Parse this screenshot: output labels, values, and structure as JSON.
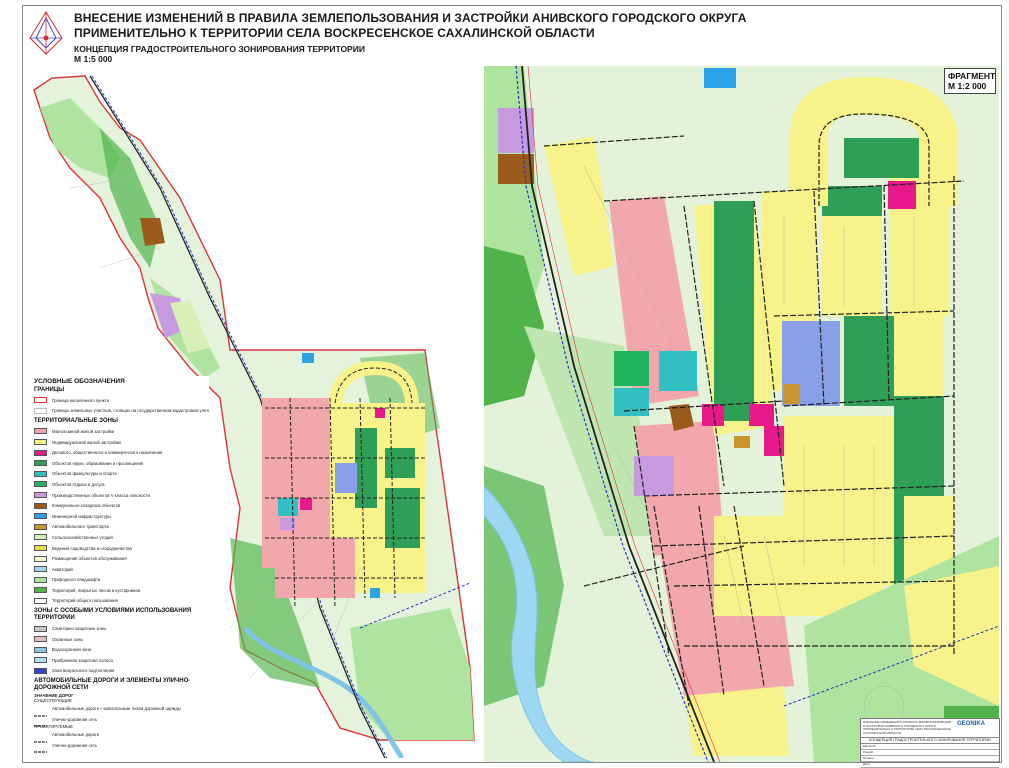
{
  "title": {
    "line1": "ВНЕСЕНИЕ ИЗМЕНЕНИЙ В ПРАВИЛА ЗЕМЛЕПОЛЬЗОВАНИЯ И ЗАСТРОЙКИ АНИВСКОГО ГОРОДСКОГО ОКРУГА",
    "line2": "ПРИМЕНИТЕЛЬНО К ТЕРРИТОРИИ СЕЛА ВОСКРЕСЕНСКОЕ САХАЛИНСКОЙ ОБЛАСТИ",
    "subtitle": "КОНЦЕПЦИЯ ГРАДОСТРОИТЕЛЬНОГО ЗОНИРОВАНИЯ ТЕРРИТОРИИ",
    "scale": "М 1:5 000"
  },
  "fragment": {
    "label": "ФРАГМЕНТ",
    "scale": "М 1:2 000"
  },
  "legend": {
    "heading": "УСЛОВНЫЕ ОБОЗНАЧЕНИЯ",
    "borders_heading": "ГРАНИЦЫ",
    "borders": [
      {
        "label": "Граница населенного пункта",
        "color": "#d9343a",
        "style": "box"
      },
      {
        "label": "Границы земельных участков, стоящих на государственном кадастровом учете",
        "color": "#bbbbbb",
        "style": "box"
      }
    ],
    "zones_heading": "ТЕРРИТОРИАЛЬНЫЕ ЗОНЫ",
    "zones": [
      {
        "label": "Малоэтажной жилой застройки",
        "color": "#f2a7ad"
      },
      {
        "label": "Индивидуальной жилой застройки",
        "color": "#f7f28a"
      },
      {
        "label": "Делового, общественного и коммерческого назначения",
        "color": "#e8198b"
      },
      {
        "label": "Объектов науки, образования и просвещения",
        "color": "#2f9e57"
      },
      {
        "label": "Объектов физкультуры и спорта",
        "color": "#31bfc1"
      },
      {
        "label": "Объектов отдыха и досуга",
        "color": "#1fb35d"
      },
      {
        "label": "Производственных объектов V класса опасности",
        "color": "#c79ae0"
      },
      {
        "label": "Коммунально-складских объектов",
        "color": "#9a5b1d"
      },
      {
        "label": "Инженерной инфраструктуры",
        "color": "#2aa4e6"
      },
      {
        "label": "Автомобильного транспорта",
        "color": "#c9952d"
      },
      {
        "label": "Сельскохозяйственных угодий",
        "color": "#d9efb8"
      },
      {
        "label": "Ведения садоводства и огородничества",
        "color": "#e1e14a"
      },
      {
        "label": "Размещения объектов обслуживания",
        "color": "#fbfbd0"
      },
      {
        "label": "Акваторий",
        "color": "#9ed7f2"
      },
      {
        "label": "Природного ландшафта",
        "color": "#aee3a0"
      },
      {
        "label": "Территорий, покрытых лесом и кустарником",
        "color": "#4fb34a"
      },
      {
        "label": "Территорий общего пользования",
        "color": "#ffffff"
      }
    ],
    "special_heading": "ЗОНЫ С ОСОБЫМИ УСЛОВИЯМИ ИСПОЛЬЗОВАНИЯ ТЕРРИТОРИИ",
    "special": [
      {
        "label": "Санитарно-защитные зоны",
        "color": "#c6c6c6"
      },
      {
        "label": "Охранные зоны",
        "color": "#e0c0c0"
      },
      {
        "label": "Водоохранная зона",
        "color": "#8fc6e8"
      },
      {
        "label": "Прибрежная защитная полоса",
        "color": "#b4e0f6"
      },
      {
        "label": "Зона визуального подтопления",
        "color": "#2b47c9"
      }
    ],
    "roads_heading": "АВТОМОБИЛЬНЫЕ ДОРОГИ И ЭЛЕМЕНТЫ УЛИЧНО-ДОРОЖНОЙ СЕТИ",
    "roads_sub1": "ЗНАЧЕНИЕ ДОРОГ",
    "roads_sub2": "СУЩЕСТВУЮЩИЕ",
    "roads": [
      {
        "label": "Автомобильные дороги с капитальным типом дорожной одежды",
        "color": "#333333"
      },
      {
        "label": "Улично-дорожная сеть",
        "color": "#333333"
      }
    ],
    "roads_sub3": "ПРОЕКТИРУЕМЫЕ",
    "roads_proj": [
      {
        "label": "Автомобильные дороги",
        "color": "#333333"
      },
      {
        "label": "Улично-дорожная сеть",
        "color": "#333333"
      }
    ]
  },
  "stamp": {
    "title": "ВНЕСЕНИЕ ИЗМЕНЕНИЙ В ПРАВИЛА ЗЕМЛЕПОЛЬЗОВАНИЯ И ЗАСТРОЙКИ АНИВСКОГО ГОРОДСКОГО ОКРУГА ПРИМЕНИТЕЛЬНО К ТЕРРИТОРИИ СЕЛА ВОСКРЕСЕНСКОЕ САХАЛИНСКОЙ ОБЛАСТИ",
    "logo": "GEONIKA",
    "sheet_name": "КОНЦЕПЦИЯ ГРАДОСТРОИТЕЛЬНОГО ЗОНИРОВАНИЯ ТЕРРИТОРИИ",
    "rows": [
      "Масштаб",
      "Разраб.",
      "Провер.",
      "Дата"
    ]
  },
  "colors": {
    "residential_low": "#f2a7ad",
    "residential_ind": "#f7f28a",
    "business": "#e8198b",
    "education": "#2f9e57",
    "sport": "#31bfc1",
    "industry": "#c79ae0",
    "utility": "#9a5b1d",
    "agri": "#d9efb8",
    "forest": "#4fb34a",
    "meadow": "#aee3a0",
    "water": "#7fc3e6",
    "boundary": "#d9343a",
    "railway": "#2236b8"
  }
}
